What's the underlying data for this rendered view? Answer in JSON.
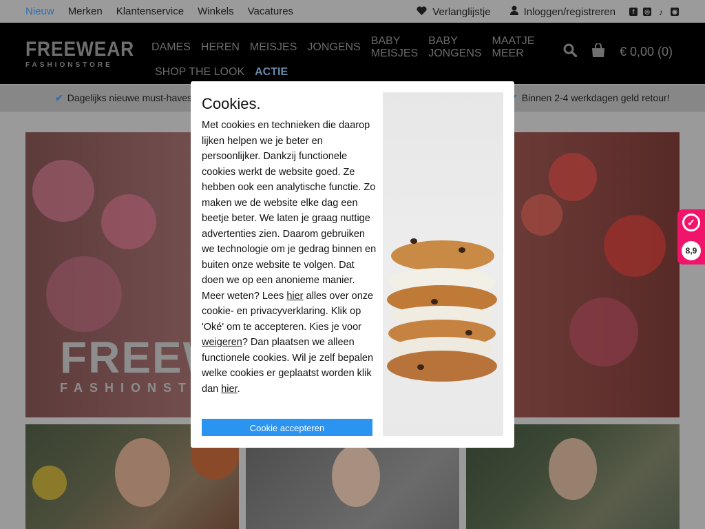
{
  "topbar": {
    "nav": [
      "Nieuw",
      "Merken",
      "Klantenservice",
      "Winkels",
      "Vacatures"
    ],
    "wishlist": "Verlanglijstje",
    "login": "Inloggen/registreren"
  },
  "header": {
    "logo_main": "FREEWEAR",
    "logo_sub": "FASHIONSTORE",
    "nav_row1": [
      "DAMES",
      "HEREN",
      "MEISJES",
      "JONGENS",
      "BABY MEISJES",
      "BABY JONGENS",
      "MAATJE MEER"
    ],
    "nav_row2": [
      "SHOP THE LOOK"
    ],
    "nav_actie": "ACTIE",
    "cart": "€ 0,00 (0)"
  },
  "usp": {
    "left": "Dagelijks nieuwe must-haves voor l",
    "right": "Binnen 2-4 werkdagen geld retour!"
  },
  "hero": {
    "logo_main": "FREEWE",
    "logo_sub": "FASHIONST"
  },
  "rating": {
    "score": "8,9"
  },
  "cookie_modal": {
    "title": "Cookies.",
    "body_1": "Met cookies en technieken die daarop lijken helpen we je beter en persoonlijker. Dankzij functionele cookies werkt de website goed. Ze hebben ook een analytische functie. Zo maken we de website elke dag een beetje beter. We laten je graag nuttige advertenties zien. Daarom gebruiken we technologie om je gedrag binnen en buiten onze website te volgen. Dat doen we op een anonieme manier. Meer weten? Lees ",
    "link_1": "hier",
    "body_2": " alles over onze cookie- en privacyverklaring. Klik op 'Oké' om te accepteren. Kies je voor ",
    "link_2": "weigeren",
    "body_3": "? Dan plaatsen we alleen functionele cookies. Wil je zelf bepalen welke cookies er geplaatst worden klik dan ",
    "link_3": "hier",
    "body_4": ".",
    "accept_button": "Cookie accepteren"
  },
  "colors": {
    "accent_blue": "#2b94f0",
    "rating_pink": "#f0156b",
    "active_nav": "#2a6fb3"
  }
}
